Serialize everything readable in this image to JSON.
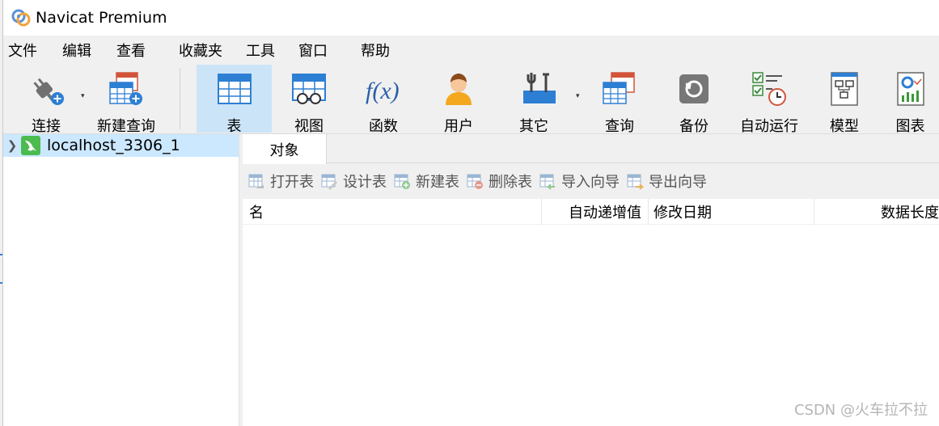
{
  "app": {
    "title": "Navicat Premium"
  },
  "menu": [
    "文件",
    "编辑",
    "查看",
    "收藏夹",
    "工具",
    "窗口",
    "帮助"
  ],
  "toolbar": {
    "connect": "连接",
    "new_query": "新建查询",
    "table": "表",
    "view": "视图",
    "function": "函数",
    "user": "用户",
    "other": "其它",
    "query": "查询",
    "backup": "备份",
    "automation": "自动运行",
    "model": "模型",
    "chart": "图表",
    "function_icon_text": "f(x)"
  },
  "sidebar": {
    "connection": "localhost_3306_1"
  },
  "tabs": {
    "objects": "对象"
  },
  "object_toolbar": {
    "open_table": "打开表",
    "design_table": "设计表",
    "new_table": "新建表",
    "delete_table": "删除表",
    "import_wizard": "导入向导",
    "export_wizard": "导出向导"
  },
  "columns": {
    "name": "名",
    "auto_increment": "自动递增值",
    "modified_date": "修改日期",
    "data_length": "数据长度"
  },
  "watermark": "CSDN @火车拉不拉",
  "colors": {
    "selected": "#cce4f7",
    "connection_selected": "#cce8ff",
    "mysql_green": "#4cbb50"
  }
}
